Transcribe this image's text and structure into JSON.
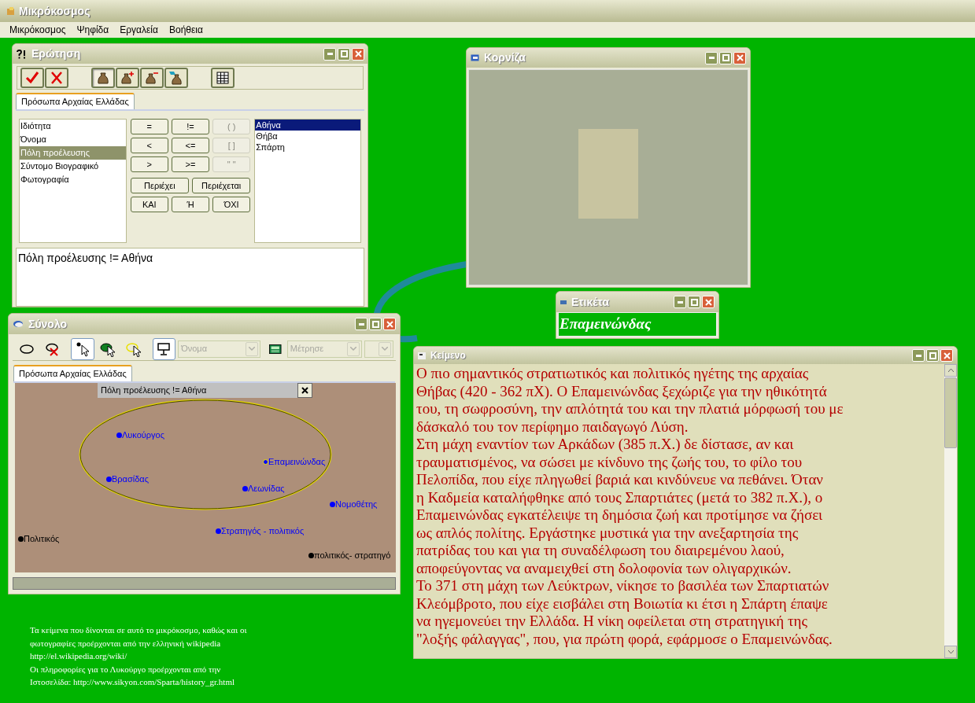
{
  "app": {
    "title": "Μικρόκοσμος",
    "menu": [
      "Μικρόκοσμος",
      "Ψηφίδα",
      "Εργαλεία",
      "Βοήθεια"
    ]
  },
  "query_window": {
    "title": "Ερώτηση",
    "toolbar": [
      {
        "kind": "accept",
        "selected": false
      },
      {
        "kind": "cancel",
        "selected": false
      },
      {
        "kind": "bag",
        "selected": true
      },
      {
        "kind": "bag-add",
        "selected": false
      },
      {
        "kind": "bag-remove",
        "selected": false
      },
      {
        "kind": "bag-edit",
        "selected": false
      },
      {
        "kind": "table",
        "selected": false
      }
    ],
    "tabs": [
      {
        "label": "Πρόσωπα Αρχαίας Ελλάδας",
        "selected": true
      }
    ],
    "properties": [
      {
        "label": "Ιδιότητα",
        "selected": false
      },
      {
        "label": "Όνομα",
        "selected": false
      },
      {
        "label": "Πόλη προέλευσης",
        "selected": true
      },
      {
        "label": "Σύντομο Βιογραφικό",
        "selected": false
      },
      {
        "label": "Φωτογραφία",
        "selected": false
      }
    ],
    "operators": [
      {
        "label": "=",
        "disabled": false
      },
      {
        "label": "!=",
        "disabled": false
      },
      {
        "label": "( )",
        "disabled": true
      },
      {
        "label": "<",
        "disabled": false
      },
      {
        "label": "<=",
        "disabled": false
      },
      {
        "label": "[ ]",
        "disabled": true
      },
      {
        "label": ">",
        "disabled": false
      },
      {
        "label": ">=",
        "disabled": false
      },
      {
        "label": "\" \"",
        "disabled": true
      }
    ],
    "text_operators": [
      "Περιέχει",
      "Περιέχεται"
    ],
    "logic_operators": [
      "ΚΑΙ",
      "Ή",
      "ΌΧΙ"
    ],
    "values": [
      {
        "label": "Αθήνα",
        "selected": true
      },
      {
        "label": "Θήβα",
        "selected": false
      },
      {
        "label": "Σπάρτη",
        "selected": false
      }
    ],
    "expression": "Πόλη προέλευσης != Αθήνα"
  },
  "set_window": {
    "title": "Σύνολο",
    "toolbar": [
      {
        "kind": "ellipse",
        "selected": false
      },
      {
        "kind": "ellipse-delete",
        "selected": false
      },
      {
        "kind": "pointer",
        "selected": true
      },
      {
        "kind": "fill-pointer",
        "selected": false
      },
      {
        "kind": "outline-pointer",
        "selected": false
      },
      {
        "kind": "display",
        "selected": true
      }
    ],
    "property_dropdown": {
      "value": "Όνομα",
      "disabled": true
    },
    "measure_dropdown": {
      "value": "Μέτρησε",
      "disabled": true
    },
    "tabs": [
      {
        "label": "Πρόσωπα Αρχαίας Ελλάδας",
        "selected": true
      }
    ],
    "filter": "Πόλη προέλευσης != Αθήνα",
    "items": [
      {
        "label": "Λυκούργος",
        "color": "#0000ff",
        "selected": false
      },
      {
        "label": "Επαμεινώνδας",
        "color": "#0000ff",
        "selected": true
      },
      {
        "label": "Βρασίδας",
        "color": "#0000ff",
        "selected": false
      },
      {
        "label": "Λεωνίδας",
        "color": "#0000ff",
        "selected": false
      },
      {
        "label": "Νομοθέτης",
        "color": "#0000ff",
        "selected": false
      },
      {
        "label": "Στρατηγός - πολιτικός",
        "color": "#0000ff",
        "selected": false
      },
      {
        "label": "Πολιτικός",
        "color": "#000000",
        "selected": false
      },
      {
        "label": "πολιτικός- στρατηγό",
        "color": "#000000",
        "selected": false
      }
    ]
  },
  "frame_window": {
    "title": "Κορνίζα"
  },
  "label_window": {
    "title": "Ετικέτα",
    "text": "Επαμεινώνδας"
  },
  "text_window": {
    "title": "Κείμενο",
    "lines": [
      "Ο πιο σημαντικός στρατιωτικός και πολιτικός ηγέτης της αρχαίας",
      "Θήβας (420 - 362 πΧ). Ο Επαμεινώνδας ξεχώριζε για την ηθικότητά",
      "του, τη σωφροσύνη, την απλότητά του και την πλατιά μόρφωσή του με",
      "δάσκαλό του τον περίφημο παιδαγωγό Λύση.",
      "Στη μάχη εναντίον των Αρκάδων (385 π.Χ.) δε δίστασε, αν και",
      "τραυματισμένος, να σώσει με κίνδυνο της ζωής του, το φίλο του",
      "Πελοπίδα, που είχε πληγωθεί βαριά και κινδύνευε να πεθάνει. Όταν",
      "η Καδμεία καταλήφθηκε από τους Σπαρτιάτες (μετά το 382 π.Χ.), ο",
      "Επαμεινώνδας εγκατέλειψε τη δημόσια ζωή και προτίμησε να ζήσει",
      "ως απλός πολίτης. Εργάστηκε μυστικά για την ανεξαρτησία της",
      "πατρίδας του και για τη συναδέλφωση του διαιρεμένου λαού,",
      "αποφεύγοντας να αναμειχθεί στη δολοφονία των ολιγαρχικών.",
      "Το 371 στη μάχη των Λεύκτρων, νίκησε το βασιλέα των Σπαρτιατών",
      "Κλεόμβροτο, που είχε εισβάλει στη Βοιωτία κι έτσι η Σπάρτη έπαψε",
      "να ηγεμονεύει την Ελλάδα. Η νίκη οφείλεται στη στρατηγική της",
      "\"λοξής φάλαγγας\", που, για πρώτη φορά, εφάρμοσε ο Επαμεινώνδας."
    ]
  },
  "credits": [
    "Τα κείμενα που δίνονται σε αυτό το μικρόκοσμο, καθώς και οι",
    "φωτογραφίες προέρχονται από την ελληνική wikipedia",
    "http://el.wikipedia.org/wiki/",
    "Οι πληροφορίες για το Λυκούργο προέρχονται από την",
    "Ιστοσελίδα: http://www.sikyon.com/Sparta/history_gr.html"
  ]
}
